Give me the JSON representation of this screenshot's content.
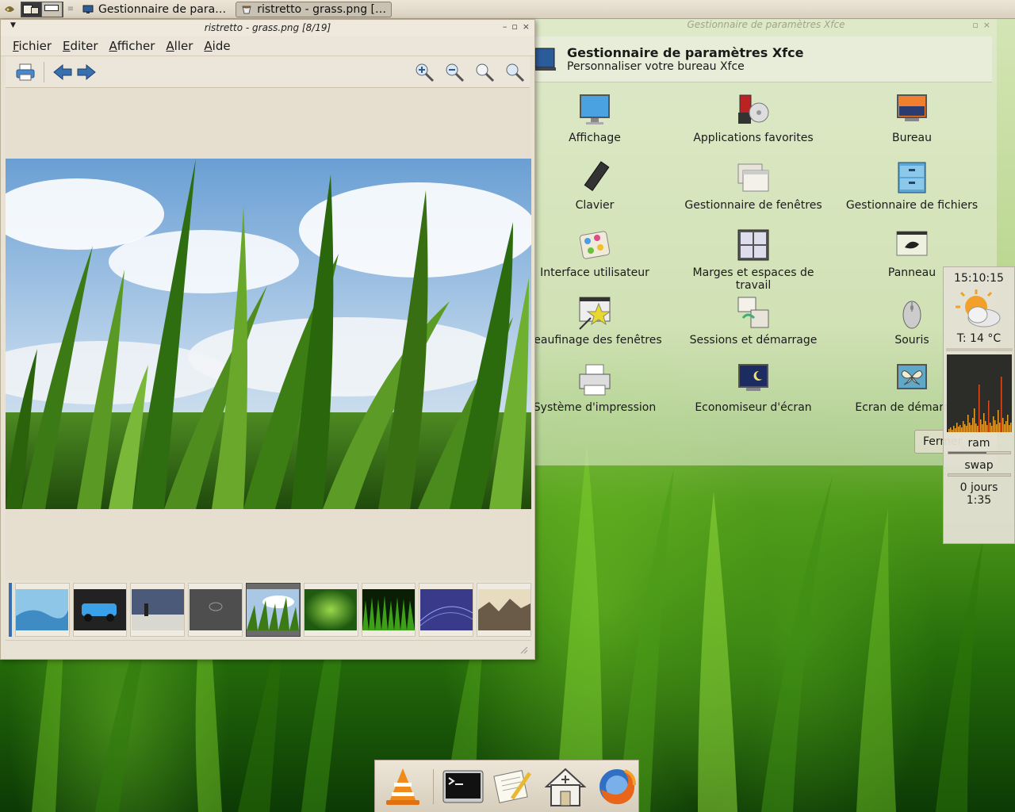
{
  "top_panel": {
    "tasks": [
      {
        "label": "Gestionnaire de para…",
        "icon": "monitor-icon"
      },
      {
        "label": "ristretto - grass.png […",
        "icon": "ristretto-icon"
      }
    ]
  },
  "ristretto": {
    "title": "ristretto - grass.png [8/19]",
    "menu": [
      "Fichier",
      "Editer",
      "Afficher",
      "Aller",
      "Aide"
    ],
    "menu_mnemonics": [
      "F",
      "E",
      "A",
      "A",
      "A"
    ],
    "toolbar": {
      "print": "print-icon",
      "back": "back-arrow-icon",
      "forward": "forward-arrow-icon",
      "zoom_in": "zoom-in-icon",
      "zoom_out": "zoom-out-icon",
      "zoom_fit": "zoom-fit-icon",
      "zoom_100": "zoom-100-icon"
    },
    "thumbnails": [
      "blue-waves",
      "blue-car",
      "walker",
      "dark-logo",
      "grass",
      "green-glow",
      "green-grass",
      "purple-lines",
      "rocks"
    ],
    "selected_thumbnail": 4
  },
  "settings": {
    "window_title": "Gestionnaire de paramètres Xfce",
    "header_title": "Gestionnaire de paramètres Xfce",
    "header_subtitle": "Personnaliser votre bureau Xfce",
    "items": [
      {
        "label": "Affichage",
        "icon": "display-icon"
      },
      {
        "label": "Applications favorites",
        "icon": "favorite-apps-icon"
      },
      {
        "label": "Bureau",
        "icon": "desktop-icon"
      },
      {
        "label": "Clavier",
        "icon": "keyboard-icon"
      },
      {
        "label": "Gestionnaire de fenêtres",
        "icon": "window-manager-icon"
      },
      {
        "label": "Gestionnaire de fichiers",
        "icon": "file-manager-icon"
      },
      {
        "label": "Interface utilisateur",
        "icon": "user-interface-icon"
      },
      {
        "label": "Marges et espaces de travail",
        "icon": "workspaces-icon"
      },
      {
        "label": "Panneau",
        "icon": "panel-icon"
      },
      {
        "label": "Peaufinage des fenêtres",
        "icon": "window-tweaks-icon"
      },
      {
        "label": "Sessions et démarrage",
        "icon": "sessions-icon"
      },
      {
        "label": "Souris",
        "icon": "mouse-icon"
      },
      {
        "label": "Système d'impression",
        "icon": "printer-icon"
      },
      {
        "label": "Economiseur d'écran",
        "icon": "screensaver-icon"
      },
      {
        "label": "Ecran de démarrage",
        "icon": "splash-icon"
      }
    ],
    "close_label": "Fermer"
  },
  "sysmon": {
    "time": "15:10:15",
    "temperature": "T: 14 °C",
    "ram_label": "ram",
    "ram_fraction": 0.62,
    "swap_label": "swap",
    "swap_fraction": 0.0,
    "uptime_days": "0 jours",
    "uptime_time": "1:35"
  },
  "dock": {
    "items": [
      "vlc-icon",
      "terminal-icon",
      "text-editor-icon",
      "home-icon",
      "firefox-icon"
    ]
  },
  "colors": {
    "window_bg": "#e8e2d5",
    "panel_bg": "#ede6d8",
    "accent_blue": "#3a6fae"
  }
}
